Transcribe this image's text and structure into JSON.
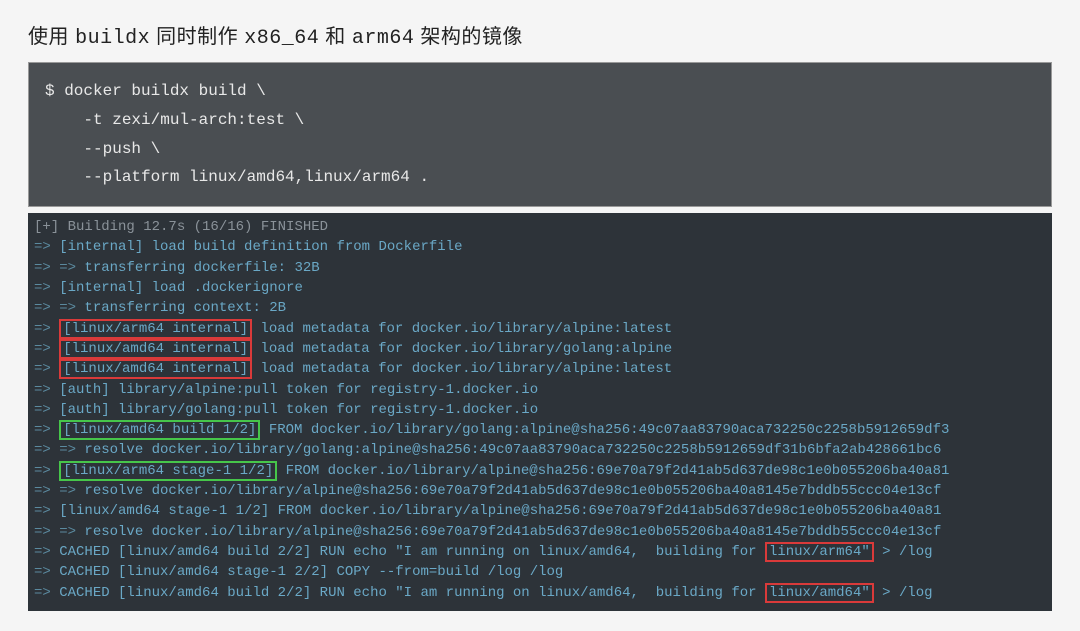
{
  "heading": {
    "p1": "使用 ",
    "mono1": "buildx",
    "p2": " 同时制作 ",
    "mono2": "x86_64",
    "p3": " 和 ",
    "mono3": "arm64",
    "p4": " 架构的镜像"
  },
  "cmd": {
    "l1": "$ docker buildx build \\",
    "l2": "    -t zexi/mul-arch:test \\",
    "l3": "    --push \\",
    "l4": "    --platform linux/amd64,linux/arm64 ."
  },
  "term": {
    "l00": "[+] Building 12.7s (16/16) FINISHED",
    "l01_a": "=> ",
    "l01_b": "[internal] load build definition from Dockerfile",
    "l02_a": "=> => ",
    "l02_b": "transferring dockerfile: 32B",
    "l03_a": "=> ",
    "l03_b": "[internal] load .dockerignore",
    "l04_a": "=> => ",
    "l04_b": "transferring context: 2B",
    "l05_a": "=> ",
    "l05_box": "[linux/arm64 internal]",
    "l05_b": " load metadata for docker.io/library/alpine:latest",
    "l06_a": "=> ",
    "l06_box": "[linux/amd64 internal]",
    "l06_b": " load metadata for docker.io/library/golang:alpine",
    "l07_a": "=> ",
    "l07_box": "[linux/amd64 internal]",
    "l07_b": " load metadata for docker.io/library/alpine:latest",
    "l08_a": "=> ",
    "l08_b": "[auth] library/alpine:pull token for registry-1.docker.io",
    "l09_a": "=> ",
    "l09_b": "[auth] library/golang:pull token for registry-1.docker.io",
    "l10_a": "=> ",
    "l10_box": "[linux/amd64 build 1/2]",
    "l10_b": " FROM docker.io/library/golang:alpine@sha256:49c07aa83790aca732250c2258b5912659df3",
    "l11_a": "=> => ",
    "l11_b": "resolve docker.io/library/golang:alpine@sha256:49c07aa83790aca732250c2258b5912659df31b6bfa2ab428661bc6",
    "l12_a": "=> ",
    "l12_box": "[linux/arm64 stage-1 1/2]",
    "l12_b": " FROM docker.io/library/alpine@sha256:69e70a79f2d41ab5d637de98c1e0b055206ba40a81",
    "l13_a": "=> => ",
    "l13_b": "resolve docker.io/library/alpine@sha256:69e70a79f2d41ab5d637de98c1e0b055206ba40a8145e7bddb55ccc04e13cf",
    "l14_a": "=> ",
    "l14_b": "[linux/amd64 stage-1 1/2] FROM docker.io/library/alpine@sha256:69e70a79f2d41ab5d637de98c1e0b055206ba40a81",
    "l15_a": "=> => ",
    "l15_b": "resolve docker.io/library/alpine@sha256:69e70a79f2d41ab5d637de98c1e0b055206ba40a8145e7bddb55ccc04e13cf",
    "l16_a": "=> ",
    "l16_b1": "CACHED [linux/amd64 build 2/2] RUN echo \"I am running on linux/amd64,  building for ",
    "l16_box": "linux/arm64\"",
    "l16_b2": " > /log",
    "l17_a": "=> ",
    "l17_b": "CACHED [linux/amd64 stage-1 2/2] COPY --from=build /log /log",
    "l18_a": "=> ",
    "l18_b1": "CACHED [linux/amd64 build 2/2] RUN echo \"I am running on linux/amd64,  building for ",
    "l18_box": "linux/amd64\"",
    "l18_b2": " > /log"
  }
}
